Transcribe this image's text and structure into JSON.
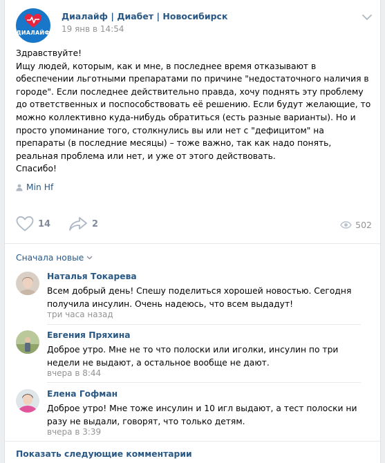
{
  "post": {
    "group_name": "Диалайф | Диабет | Новосибирск",
    "logo_text": "ДИАЛАЙФ",
    "date": "19 янв в 14:54",
    "text": "Здравствуйте!\nИщу людей, которым, как и мне, в последнее время отказывают в обеспечении льготными препаратами по причине \"недостаточного наличия в городе\". Если последнее действительно правда, хочу поднять эту проблему до ответственных и поспособствовать её решению. Если будут желающие, то можно коллективно куда-нибудь обратиться (есть разные варианты). Но и просто упоминание того, столкнулись вы или нет с \"дефицитом\" на препараты (в последние месяцы) – тоже важно, так как надо понять, реальная проблема или нет, и уже от этого действовать.\nСпасибо!",
    "signer": "Min Hf",
    "likes": "14",
    "shares": "2",
    "views": "502"
  },
  "comments_section": {
    "sort_label": "Сначала новые",
    "more_label": "Показать следующие комментарии",
    "items": [
      {
        "author": "Наталья Токарева",
        "text": "Всем добрый день! Спешу поделиться хорошей новостью. Сегодня получила инсулин. Очень надеюсь, что всем выдадут!",
        "time": "три часа назад"
      },
      {
        "author": "Евгения Пряхина",
        "text": "Доброе утро. Мне не то что полоски или иголки, инсулин по три недели не выдают, а остальное вообще не дают.",
        "time": "вчера в 8:44"
      },
      {
        "author": "Елена Гофман",
        "text": "Доброе утро! Мне тоже инсулин и 10 игл выдают, а тест полоски ни разу не выдали, говорят, что только детям.",
        "time": "вчера в 3:39"
      }
    ]
  },
  "colors": {
    "link": "#2a5885",
    "meta": "#939393",
    "brand_blue": "#1877c8",
    "heart_red": "#e8243f",
    "icon_gray": "#adb8c6"
  }
}
